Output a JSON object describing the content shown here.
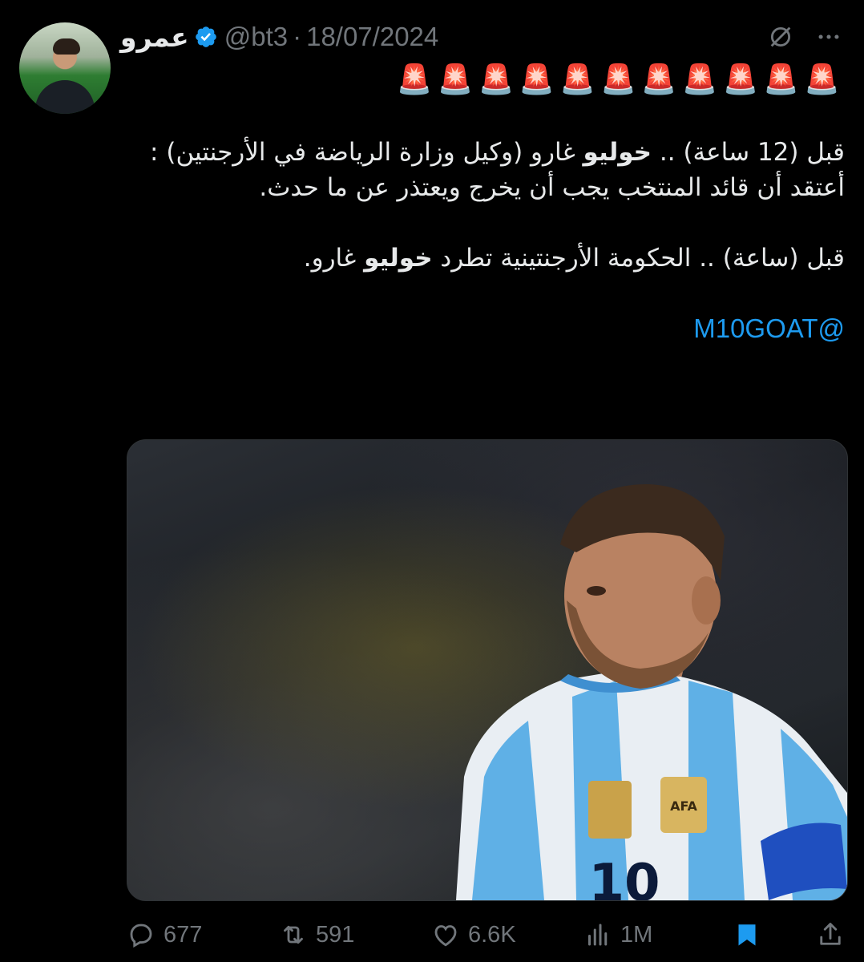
{
  "tweet": {
    "author": {
      "display_name": "عمرو",
      "handle": "@bt3",
      "verified": true,
      "avatar_icon": "profile-photo"
    },
    "separator": "·",
    "date": "18/07/2024",
    "sirens": "🚨🚨🚨🚨🚨🚨🚨🚨🚨🚨🚨",
    "paragraph1": {
      "prefix": "قبل (12 ساعة) .. ",
      "bold": "خوليو",
      "suffix": " غارو (وكيل وزارة الرياضة في الأرجنتين) : أعتقد أن قائد المنتخب يجب أن يخرج ويعتذر عن ما حدث."
    },
    "paragraph2": {
      "prefix": "قبل (ساعة) .. الحكومة الأرجنتينية تطرد ",
      "bold": "خوليو",
      "suffix": " غارو."
    },
    "mention": "@M10GOAT",
    "media": {
      "type": "photo",
      "jersey_number": "10"
    },
    "actions": {
      "replies": "677",
      "retweets": "591",
      "likes": "6.6K",
      "views": "1M",
      "bookmarked": true
    }
  },
  "colors": {
    "background": "#000000",
    "text": "#e7e9ea",
    "muted": "#71767b",
    "accent": "#1d9bf0"
  },
  "icons": [
    "verified-badge-icon",
    "grok-icon",
    "more-icon",
    "reply-icon",
    "retweet-icon",
    "like-icon",
    "views-icon",
    "bookmark-icon",
    "share-icon"
  ]
}
